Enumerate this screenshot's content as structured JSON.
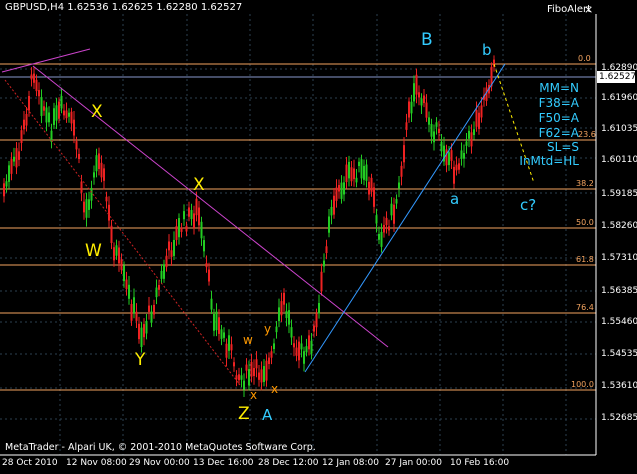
{
  "window": {
    "title": "GBPUSD,H4  1.62536 1.62625 1.62280 1.62527",
    "indicator_name": "FiboAlert",
    "close_glyph": "×",
    "copyright": "MetaTrader - Alpari UK, © 2001-2010 MetaQuotes Software Corp."
  },
  "price_axis": {
    "labels": [
      "1.62890",
      "1.61960",
      "1.61035",
      "1.60110",
      "1.59185",
      "1.58260",
      "1.57310",
      "1.56385",
      "1.55460",
      "1.54535",
      "1.53610",
      "1.52685"
    ],
    "current_price": "1.62527"
  },
  "time_axis": {
    "labels": [
      "28 Oct 2010",
      "12 Nov 08:00",
      "29 Nov 00:00",
      "13 Dec 16:00",
      "28 Dec 12:00",
      "12 Jan 08:00",
      "27 Jan 00:00",
      "10 Feb 16:00"
    ]
  },
  "fibo_levels": [
    "0.0",
    "23.6",
    "38.2",
    "50.0",
    "61.8",
    "76.4",
    "100.0"
  ],
  "info_panel": [
    "MM=N",
    "F38=A",
    "F50=A",
    "F62=A",
    "SL=S",
    "InMtd=HL"
  ],
  "wave_labels": {
    "X1": "X",
    "W": "W",
    "Y": "Y",
    "X2": "X",
    "Z": "Z",
    "A": "A",
    "B": "B",
    "a": "a",
    "b": "b",
    "c": "c?",
    "x_small1": "x",
    "x_small2": "x",
    "w_small": "w",
    "y_small": "y"
  },
  "colors": {
    "background": "#000000",
    "bull_candle": "#22cc22",
    "bear_candle": "#ee2222",
    "fibo": "#f4a460",
    "grid": "#2c4050",
    "trend_magenta": "#cc44cc",
    "trend_blue": "#3399ff",
    "wave_yellow": "#ffee00",
    "wave_cyan": "#33ccff",
    "info_text": "#33ccff"
  }
}
